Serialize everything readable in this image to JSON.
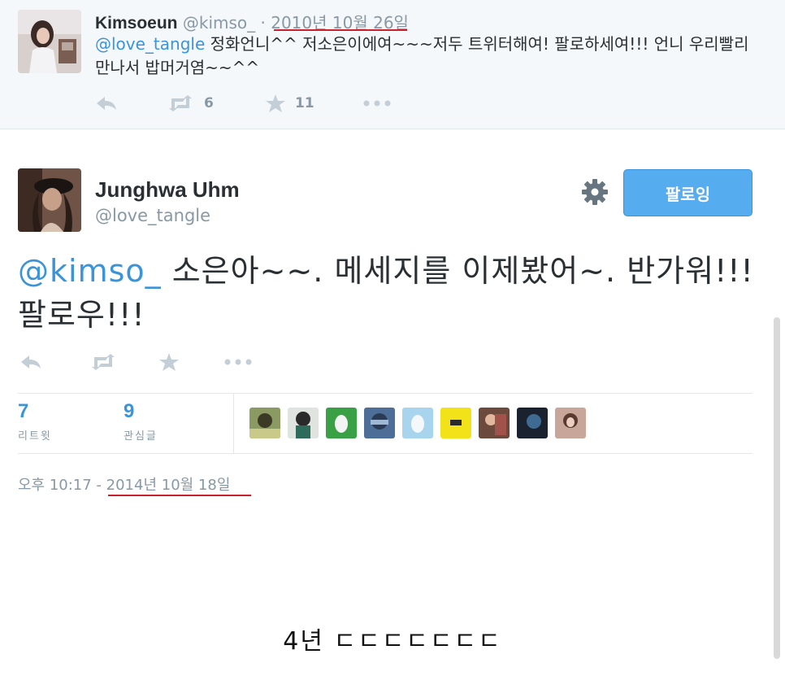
{
  "reply_tweet": {
    "name": "Kimsoeun",
    "handle": "@kimso_",
    "separator": "·",
    "date": "2010년 10월 26일",
    "mention": "@love_tangle",
    "text": " 정화언니^^ 저소은이에여~~~저두 트위터해여! 팔로하세여!!! 언니 우리빨리만나서 밥머거염~~^^",
    "retweet_count": "6",
    "favorite_count": "11"
  },
  "main_tweet": {
    "name": "Junghwa Uhm",
    "handle": "@love_tangle",
    "follow_label": "팔로잉",
    "mention": "@kimso_",
    "text": " 소은아~~. 메세지를 이제봤어~. 반가워!!!  팔로우!!!",
    "stats": {
      "retweets_value": "7",
      "retweets_label": "리트윗",
      "favorites_value": "9",
      "favorites_label": "관심글"
    },
    "timestamp": "오후 10:17 - 2014년 10월 18일"
  },
  "caption": "4년 ㄷㄷㄷㄷㄷㄷㄷ",
  "colors": {
    "accent": "#55acee",
    "link": "#3b94d9",
    "muted": "#8899a6",
    "underline": "#c9202b"
  },
  "icons": [
    "reply-icon",
    "retweet-icon",
    "favorite-icon",
    "more-icon",
    "gear-icon",
    "egg-icon"
  ]
}
